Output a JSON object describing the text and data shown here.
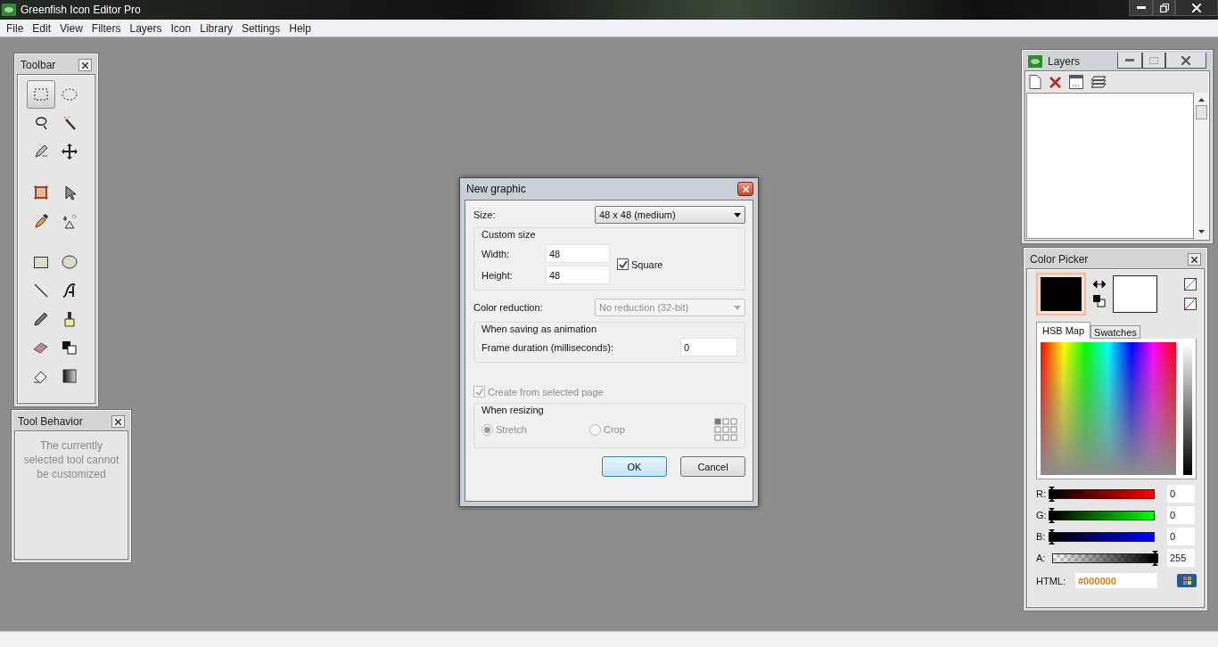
{
  "window": {
    "title": "Greenfish Icon Editor Pro"
  },
  "menu": [
    "File",
    "Edit",
    "View",
    "Filters",
    "Layers",
    "Icon",
    "Library",
    "Settings",
    "Help"
  ],
  "toolbar_panel": {
    "title": "Toolbar",
    "tools": [
      {
        "kind": "rect-select",
        "selected": true
      },
      {
        "kind": "ellipse-select",
        "selected": false
      },
      {
        "kind": "lasso",
        "selected": false
      },
      {
        "kind": "wand",
        "selected": false
      },
      {
        "kind": "pencil-select",
        "selected": false
      },
      {
        "kind": "move",
        "selected": false
      },
      {
        "kind": "crop",
        "selected": false
      },
      {
        "kind": "pointer",
        "selected": false
      },
      {
        "kind": "eyedropper",
        "selected": false
      },
      {
        "kind": "effects",
        "selected": false
      },
      {
        "kind": "rectangle",
        "selected": false
      },
      {
        "kind": "ellipse",
        "selected": false
      },
      {
        "kind": "line",
        "selected": false
      },
      {
        "kind": "curve",
        "selected": false
      },
      {
        "kind": "pencil",
        "selected": false
      },
      {
        "kind": "brush",
        "selected": false
      },
      {
        "kind": "eraser",
        "selected": false
      },
      {
        "kind": "replace",
        "selected": false
      },
      {
        "kind": "fill",
        "selected": false
      },
      {
        "kind": "gradient",
        "selected": false
      }
    ]
  },
  "tool_behavior": {
    "title": "Tool Behavior",
    "message": "The currently selected tool cannot be customized"
  },
  "dialog": {
    "title": "New graphic",
    "size_label": "Size:",
    "size_value": "48 x 48 (medium)",
    "custom_size": {
      "title": "Custom size",
      "width_label": "Width:",
      "width_value": "48",
      "height_label": "Height:",
      "height_value": "48",
      "square": {
        "label": "Square",
        "checked": true
      }
    },
    "color_reduction": {
      "label": "Color reduction:",
      "value": "No reduction (32-bit)",
      "disabled": true
    },
    "animation": {
      "title": "When saving as animation",
      "frame_label": "Frame duration (milliseconds):",
      "frame_value": "0"
    },
    "create_from_page": {
      "label": "Create from selected page",
      "checked": true,
      "disabled": true
    },
    "resizing": {
      "title": "When resizing",
      "options": [
        {
          "label": "Stretch",
          "selected": true
        },
        {
          "label": "Crop",
          "selected": false
        }
      ],
      "disabled": true
    },
    "buttons": [
      {
        "label": "OK",
        "default": true
      },
      {
        "label": "Cancel",
        "default": false
      }
    ]
  },
  "layers": {
    "title": "Layers"
  },
  "color_picker": {
    "title": "Color Picker",
    "tabs": [
      {
        "label": "HSB Map",
        "selected": true
      },
      {
        "label": "Swatches",
        "selected": false
      }
    ],
    "channels": [
      {
        "label": "R:",
        "kind": "red",
        "level": 0,
        "reading": "0"
      },
      {
        "label": "G:",
        "kind": "green",
        "level": 0,
        "reading": "0"
      },
      {
        "label": "B:",
        "kind": "blue",
        "level": 0,
        "reading": "0"
      },
      {
        "label": "A:",
        "kind": "alpha",
        "level": 1,
        "reading": "255"
      }
    ],
    "html_label": "HTML:",
    "html_value": "#000000"
  }
}
